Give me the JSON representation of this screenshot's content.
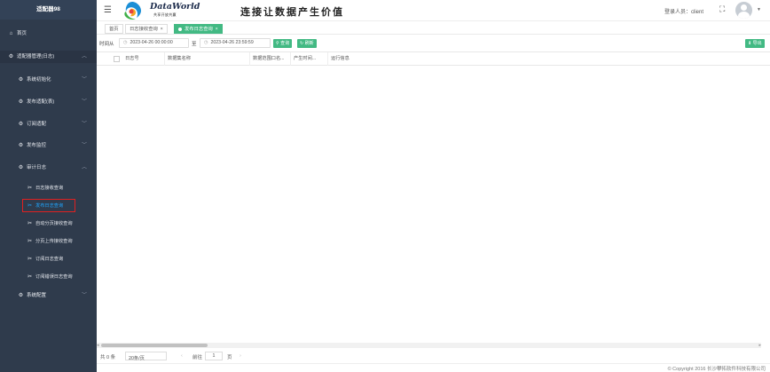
{
  "sidebar": {
    "title": "适配器98",
    "items": [
      {
        "label": "首页"
      },
      {
        "label": "适配器管理(日志)"
      },
      {
        "label": "系统初始化"
      },
      {
        "label": "发布适配(表)"
      },
      {
        "label": "订阅适配"
      },
      {
        "label": "发布监控"
      },
      {
        "label": "审计日志"
      },
      {
        "label": "日志接收查询"
      },
      {
        "label": "发布日志查询"
      },
      {
        "label": "自动分页接收查询"
      },
      {
        "label": "分页上传接收查询"
      },
      {
        "label": "订阅日志查询"
      },
      {
        "label": "订阅错误日志查询"
      },
      {
        "label": "系统配置"
      }
    ]
  },
  "header": {
    "logo_text": "DataWorld",
    "logo_sub": "共享开放共赢",
    "slogan": "连接让数据产生价值",
    "user_label": "登录人员：client"
  },
  "tabs": [
    {
      "label": "首页"
    },
    {
      "label": "日志接收查询"
    },
    {
      "label": "发布日志查询"
    }
  ],
  "filter": {
    "label": "时间从",
    "start": "2023-04-26 00:00:00",
    "separator": "至",
    "end": "2023-04-26 23:59:59",
    "query_label": "查询",
    "reset_label": "刷新",
    "export_label": "导出"
  },
  "table": {
    "columns": [
      "日志号",
      "数据集名称",
      "数据范围口名...",
      "产生时间...",
      "运行信息"
    ]
  },
  "pager": {
    "total": "共 0 条",
    "page_size": "20条/页",
    "goto_label": "前往",
    "page": "1",
    "page_suffix": "页"
  },
  "footer": {
    "copyright": "© Copyright 2016 长沙攀拓软件科技有限公司"
  },
  "colors": {
    "sidebar_bg": "#2f3b4c",
    "accent": "#42b983",
    "selected_text": "#1fa6ff",
    "highlight_border": "#e02020"
  }
}
